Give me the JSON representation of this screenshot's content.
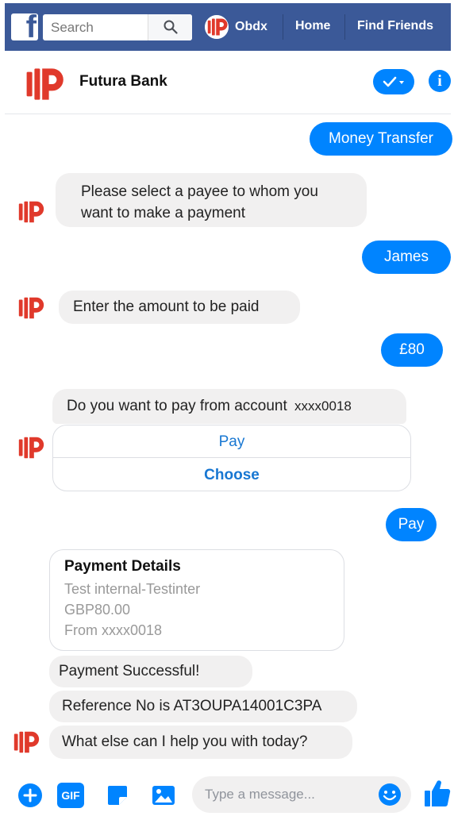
{
  "facebook_bar": {
    "logo": "f",
    "search": {
      "placeholder": "Search",
      "icon": "search-icon"
    },
    "user_name": "Obdx",
    "nav": [
      "Home",
      "Find Friends"
    ]
  },
  "chat_header": {
    "title": "Futura Bank",
    "icons": [
      "check-icon",
      "info-icon"
    ],
    "info_glyph": "i"
  },
  "conversation": {
    "user_1": "Money Transfer",
    "bot_1": [
      "Please select a payee to whom you",
      "want to make a payment"
    ],
    "user_2": "James",
    "bot_2": "Enter the amount to be paid",
    "user_3": "£80",
    "bot_3": {
      "text": "Do you want to pay from account",
      "account": "xxxx0018"
    },
    "quick_replies": [
      "Pay",
      "Choose"
    ],
    "user_4": "Pay",
    "payment_card": {
      "title": "Payment Details",
      "lines": [
        "Test internal-Testinter",
        "GBP80.00",
        "From xxxx0018"
      ]
    },
    "bot_4": "Payment Successful!",
    "bot_5": "Reference No is AT3OUPA14001C3PA",
    "bot_6": "What else can I help you with today?"
  },
  "composer": {
    "placeholder": "Type a message...",
    "gif_label": "GIF",
    "icons": [
      "plus-icon",
      "gif-icon",
      "sticker-icon",
      "image-icon",
      "emoji-icon",
      "like-icon"
    ]
  },
  "colors": {
    "facebook_blue": "#3b5998",
    "messenger_blue": "#0084ff",
    "bot_bubble": "#f1f0f0",
    "futura_red": "#e0392b"
  }
}
